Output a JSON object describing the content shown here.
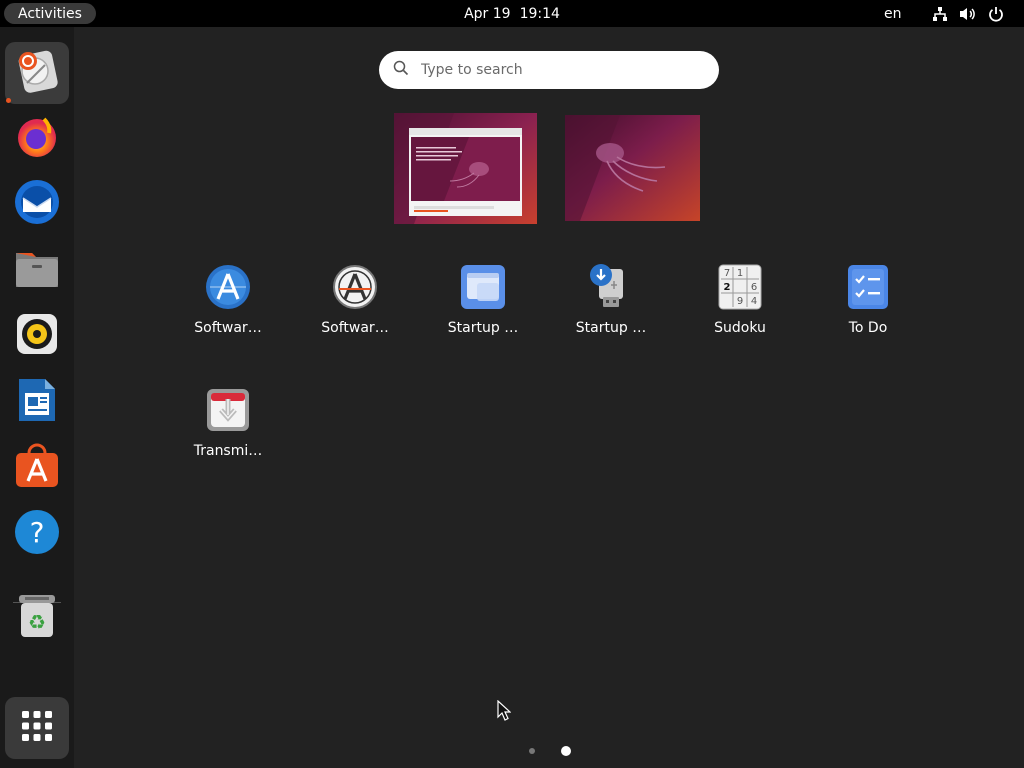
{
  "topbar": {
    "activities_label": "Activities",
    "date": "Apr 19",
    "time": "19:14",
    "language": "en",
    "tray_icons": [
      "network-icon",
      "volume-icon",
      "power-icon"
    ]
  },
  "dock": {
    "items": [
      {
        "name": "ubuntu-installer",
        "icon": "installer-icon",
        "running": true,
        "active": true
      },
      {
        "name": "firefox",
        "icon": "firefox-icon"
      },
      {
        "name": "thunderbird",
        "icon": "thunderbird-icon"
      },
      {
        "name": "files",
        "icon": "files-icon"
      },
      {
        "name": "rhythmbox",
        "icon": "rhythmbox-icon"
      },
      {
        "name": "libreoffice-writer",
        "icon": "writer-icon"
      },
      {
        "name": "ubuntu-software",
        "icon": "software-store-icon"
      },
      {
        "name": "help",
        "icon": "help-icon"
      },
      {
        "name": "trash",
        "icon": "trash-icon"
      }
    ],
    "show_apps_icon": "app-grid-icon",
    "accent_color": "#e95420"
  },
  "search": {
    "placeholder": "Type to search"
  },
  "workspaces": [
    {
      "name": "workspace-1",
      "has_window": true
    },
    {
      "name": "workspace-2",
      "has_window": false
    }
  ],
  "apps": [
    {
      "label": "Softwar…",
      "icon": "software-updater-icon"
    },
    {
      "label": "Softwar…",
      "icon": "software-properties-icon"
    },
    {
      "label": "Startup …",
      "icon": "startup-apps-icon"
    },
    {
      "label": "Startup …",
      "icon": "startup-disk-creator-icon"
    },
    {
      "label": "Sudoku",
      "icon": "sudoku-icon"
    },
    {
      "label": "To Do",
      "icon": "todo-icon"
    },
    {
      "label": "Transmi…",
      "icon": "transmission-icon"
    }
  ],
  "pager": {
    "pages": 2,
    "current_page": 2
  }
}
